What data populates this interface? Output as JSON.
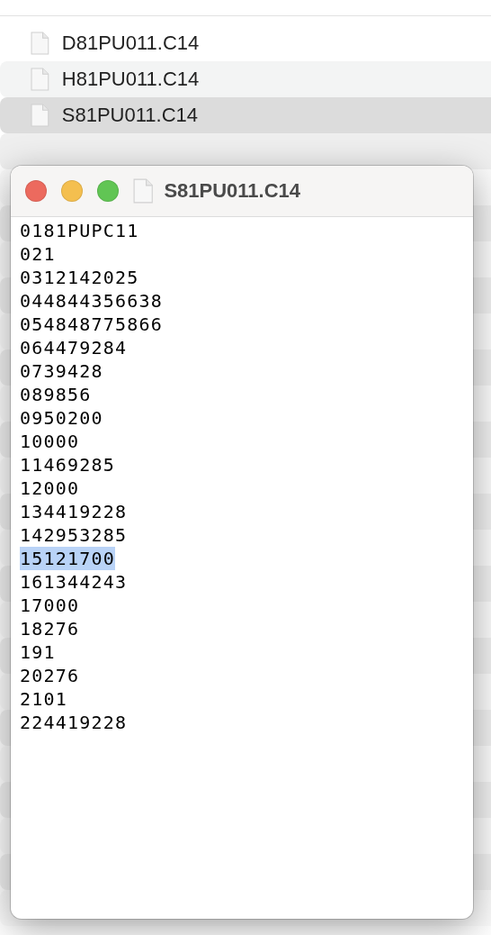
{
  "files": [
    {
      "name": "D81PU011.C14",
      "selected": false
    },
    {
      "name": "H81PU011.C14",
      "selected": false
    },
    {
      "name": "S81PU011.C14",
      "selected": true
    }
  ],
  "preview": {
    "title": "S81PU011.C14",
    "lines": [
      {
        "text": "0181PUPC11",
        "selected": false
      },
      {
        "text": "021",
        "selected": false
      },
      {
        "text": "0312142025",
        "selected": false
      },
      {
        "text": "044844356638",
        "selected": false
      },
      {
        "text": "054848775866",
        "selected": false
      },
      {
        "text": "064479284",
        "selected": false
      },
      {
        "text": "0739428",
        "selected": false
      },
      {
        "text": "089856",
        "selected": false
      },
      {
        "text": "0950200",
        "selected": false
      },
      {
        "text": "10000",
        "selected": false
      },
      {
        "text": "11469285",
        "selected": false
      },
      {
        "text": "12000",
        "selected": false
      },
      {
        "text": "134419228",
        "selected": false
      },
      {
        "text": "142953285",
        "selected": false
      },
      {
        "text": "15121700",
        "selected": true
      },
      {
        "text": "161344243",
        "selected": false
      },
      {
        "text": "17000",
        "selected": false
      },
      {
        "text": "18276",
        "selected": false
      },
      {
        "text": "191",
        "selected": false
      },
      {
        "text": "20276",
        "selected": false
      },
      {
        "text": "2101",
        "selected": false
      },
      {
        "text": "224419228",
        "selected": false
      }
    ]
  }
}
